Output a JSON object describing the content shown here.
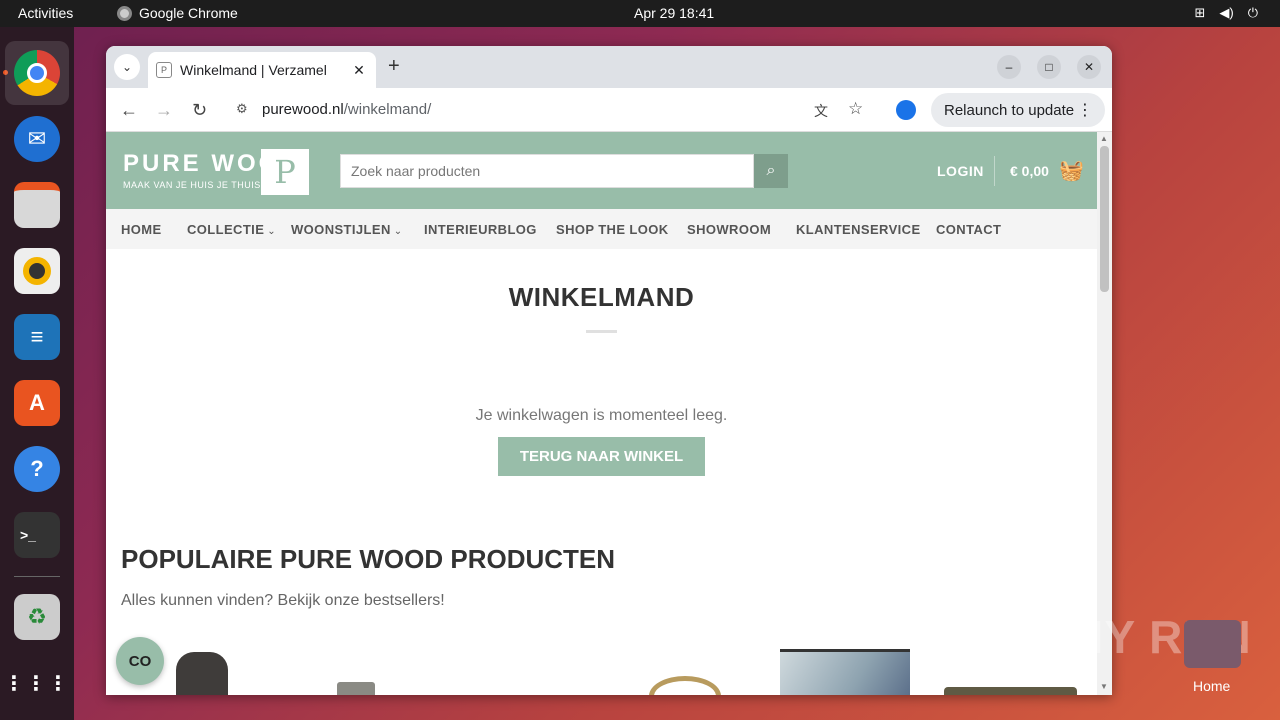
{
  "system": {
    "activities": "Activities",
    "app_name": "Google Chrome",
    "clock": "Apr 29  18:41"
  },
  "browser": {
    "tab_title": "Winkelmand | Verzamel",
    "url_host": "purewood.nl",
    "url_path": "/winkelmand/",
    "relaunch_label": "Relaunch to update"
  },
  "site": {
    "brand": "PURE WOOD",
    "tagline": "MAAK VAN JE HUIS JE THUIS",
    "search_placeholder": "Zoek naar producten",
    "login": "LOGIN",
    "cart_total": "€ 0,00",
    "nav": [
      {
        "label": "HOME",
        "dropdown": false
      },
      {
        "label": "COLLECTIE",
        "dropdown": true
      },
      {
        "label": "WOONSTIJLEN",
        "dropdown": true
      },
      {
        "label": "INTERIEURBLOG",
        "dropdown": false
      },
      {
        "label": "SHOP THE LOOK",
        "dropdown": false
      },
      {
        "label": "SHOWROOM",
        "dropdown": false
      },
      {
        "label": "KLANTENSERVICE",
        "dropdown": false
      },
      {
        "label": "CONTACT",
        "dropdown": false
      }
    ],
    "page_title": "WINKELMAND",
    "empty_message": "Je winkelwagen is momenteel leeg.",
    "back_button": "TERUG NAAR WINKEL",
    "popular_title": "POPULAIRE PURE WOOD PRODUCTEN",
    "popular_subtitle": "Alles kunnen vinden? Bekijk onze bestsellers!",
    "cookie_icon_text": "CO"
  },
  "desktop": {
    "watermark": "ANY RUN",
    "home_label": "Home"
  },
  "colors": {
    "brand_green": "#98bda9",
    "search_button": "#7e9e8c",
    "ubuntu_orange": "#e95420"
  }
}
